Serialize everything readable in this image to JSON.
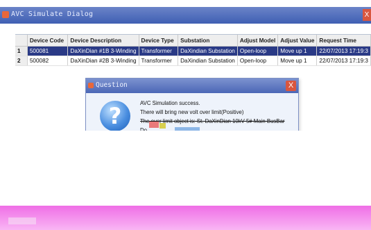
{
  "window": {
    "title": "AVC Simulate Dialog",
    "close_glyph": "X"
  },
  "table": {
    "headers": [
      "Device Code",
      "Device Description",
      "Device Type",
      "Substation",
      "Adjust Model",
      "Adjust Value",
      "Request Time"
    ],
    "rows": [
      {
        "n": "1",
        "cells": [
          "500081",
          "DaXinDian #1B 3-Winding",
          "Transformer",
          "DaXindian Substation",
          "Open-loop",
          "Move up 1",
          "22/07/2013 17:19:3"
        ]
      },
      {
        "n": "2",
        "cells": [
          "500082",
          "DaXinDian #2B 3-Winding",
          "Transformer",
          "DaXindian Substation",
          "Open-loop",
          "Move up 1",
          "22/07/2013 17:19:3"
        ]
      }
    ]
  },
  "dialog": {
    "title": "Question",
    "close_glyph": "X",
    "icon": "question-icon",
    "icon_glyph": "?",
    "lines": [
      "AVC Simulation success.",
      "There will bring new volt over limit(Positive)",
      "The over limit object is: St. DaXinDian 10kV 5# Main BusBar",
      "Do"
    ]
  },
  "colors": {
    "title_bar": "#3f5fb3",
    "selected_row": "#2a3a86",
    "bottom_band": "#ef6ee6"
  }
}
